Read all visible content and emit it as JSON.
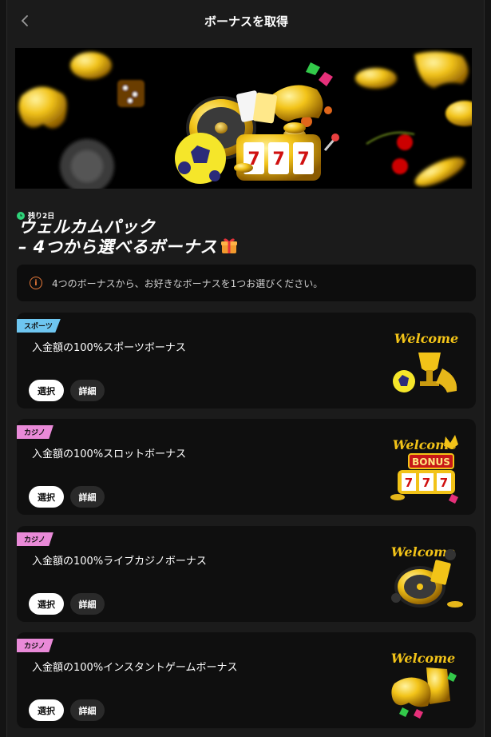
{
  "header": {
    "title": "ボーナスを取得"
  },
  "banner": {
    "alt_icon": "casino-banner"
  },
  "welcome_pack": {
    "timer": "残り2日",
    "title_line1": "ウェルカムパック",
    "title_line2": "– 4つから選べるボーナス"
  },
  "notice": {
    "text": "4つのボーナスから、お好きなボーナスを1つお選びください。"
  },
  "bonuses": [
    {
      "tag": "スポーツ",
      "tag_color": "#6ec6f0",
      "title": "入金額の100%スポーツボーナス",
      "select": "選択",
      "detail": "詳細"
    },
    {
      "tag": "カジノ",
      "tag_color": "#e98ad8",
      "title": "入金額の100%スロットボーナス",
      "select": "選択",
      "detail": "詳細"
    },
    {
      "tag": "カジノ",
      "tag_color": "#e98ad8",
      "title": "入金額の100%ライブカジノボーナス",
      "select": "選択",
      "detail": "詳細"
    },
    {
      "tag": "カジノ",
      "tag_color": "#e98ad8",
      "title": "入金額の100%インスタントゲームボーナス",
      "select": "選択",
      "detail": "詳細"
    }
  ],
  "welcome_art": {
    "word": "Welcome",
    "bonus": "BONUS"
  }
}
